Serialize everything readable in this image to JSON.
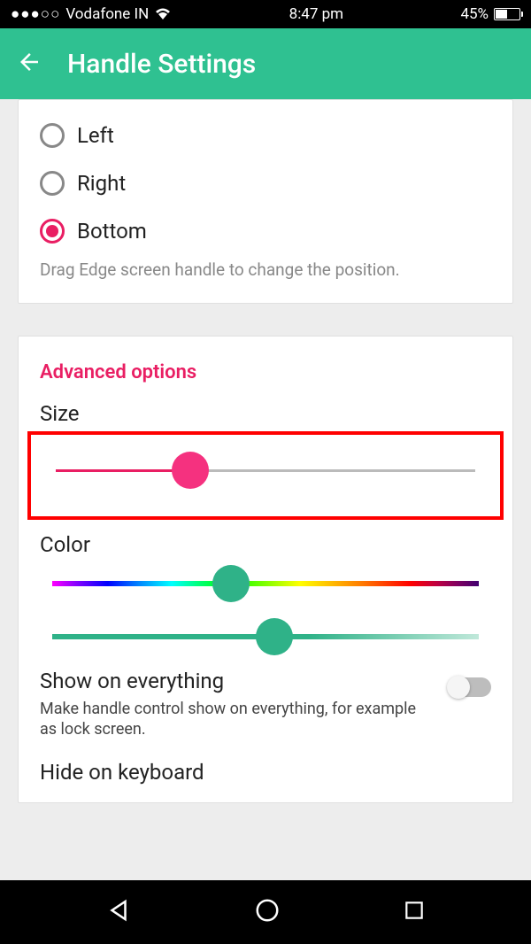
{
  "status": {
    "carrier": "Vodafone IN",
    "time": "8:47 pm",
    "battery_pct": "45%"
  },
  "appbar": {
    "title": "Handle Settings"
  },
  "position": {
    "options": [
      {
        "label": "Left",
        "selected": false
      },
      {
        "label": "Right",
        "selected": false
      },
      {
        "label": "Bottom",
        "selected": true
      }
    ],
    "helper": "Drag Edge screen handle to change the position."
  },
  "advanced": {
    "header": "Advanced options",
    "size_label": "Size",
    "size_value_pct": 32,
    "color_label": "Color",
    "hue_value_pct": 42,
    "saturation_value_pct": 52,
    "show_label": "Show on everything",
    "show_sub": "Make handle control show on everything, for example as lock screen.",
    "show_enabled": false,
    "partial_next": "Hide on keyboard"
  }
}
